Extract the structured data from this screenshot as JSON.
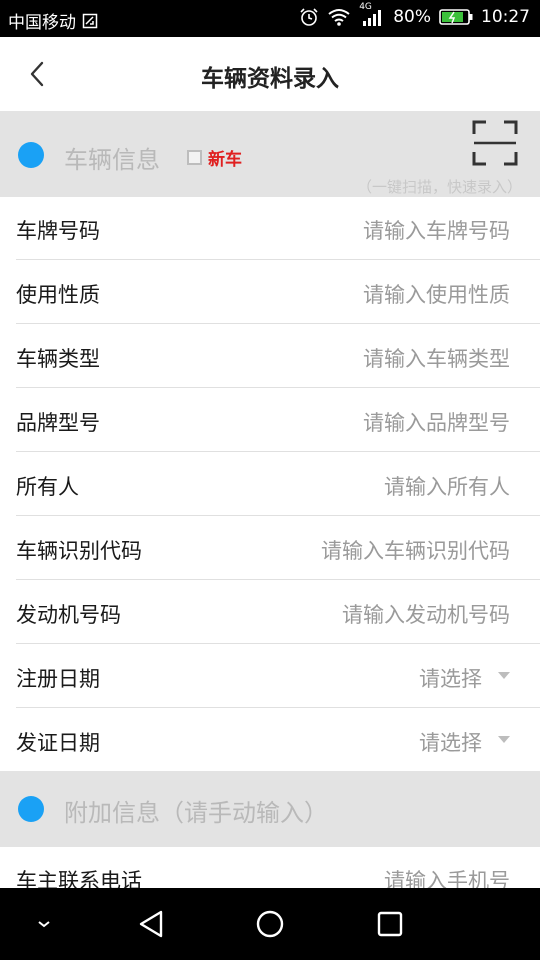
{
  "status_bar": {
    "carrier": "中国移动",
    "network": "4G",
    "battery": "80%",
    "time": "10:27",
    "icons": [
      "sim-icon",
      "alarm-icon",
      "wifi-icon",
      "signal-icon",
      "battery-icon"
    ]
  },
  "header": {
    "title": "车辆资料录入",
    "back_icon": "back-arrow-icon"
  },
  "vehicle_section": {
    "title": "车辆信息",
    "new_car_label": "新车",
    "scan_icon": "scan-icon",
    "scan_hint": "（一键扫描，快速录入）"
  },
  "fields": [
    {
      "label": "车牌号码",
      "placeholder": "请输入车牌号码"
    },
    {
      "label": "使用性质",
      "placeholder": "请输入使用性质"
    },
    {
      "label": "车辆类型",
      "placeholder": "请输入车辆类型"
    },
    {
      "label": "品牌型号",
      "placeholder": "请输入品牌型号"
    },
    {
      "label": "所有人",
      "placeholder": "请输入所有人"
    },
    {
      "label": "车辆识别代码",
      "placeholder": "请输入车辆识别代码"
    },
    {
      "label": "发动机号码",
      "placeholder": "请输入发动机号码"
    },
    {
      "label": "注册日期",
      "placeholder": "请选择"
    },
    {
      "label": "发证日期",
      "placeholder": "请选择"
    }
  ],
  "extra_section": {
    "title": "附加信息（请手动输入）"
  },
  "extra_fields": [
    {
      "label": "车主联系电话",
      "placeholder": "请输入手机号"
    }
  ],
  "colors": {
    "accent": "#1aa1f5",
    "new_car": "#e02020",
    "section_bg": "#e3e3e3"
  },
  "nav_bar": {
    "icons": [
      "hide-keyboard-icon",
      "back-triangle-icon",
      "home-circle-icon",
      "recents-square-icon"
    ]
  }
}
